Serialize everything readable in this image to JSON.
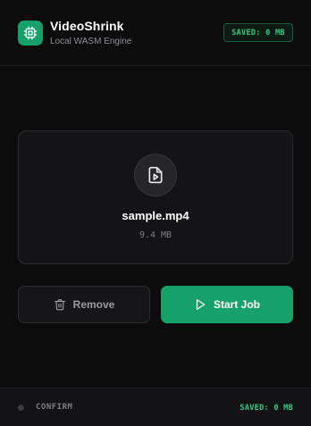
{
  "header": {
    "app_title": "VideoShrink",
    "app_subtitle": "Local WASM Engine",
    "saved_badge": "SAVED: 0 MB"
  },
  "file": {
    "name": "sample.mp4",
    "size": "9.4 MB"
  },
  "actions": {
    "remove_label": "Remove",
    "start_label": "Start Job"
  },
  "footer": {
    "status": "CONFIRM",
    "saved": "SAVED: 0 MB"
  },
  "colors": {
    "accent": "#16a06a",
    "accent_text": "#2fcf8a",
    "background": "#0c0c0d"
  },
  "icons": {
    "logo": "chip-icon",
    "file": "video-file-icon",
    "remove": "trash-icon",
    "start": "play-icon"
  }
}
